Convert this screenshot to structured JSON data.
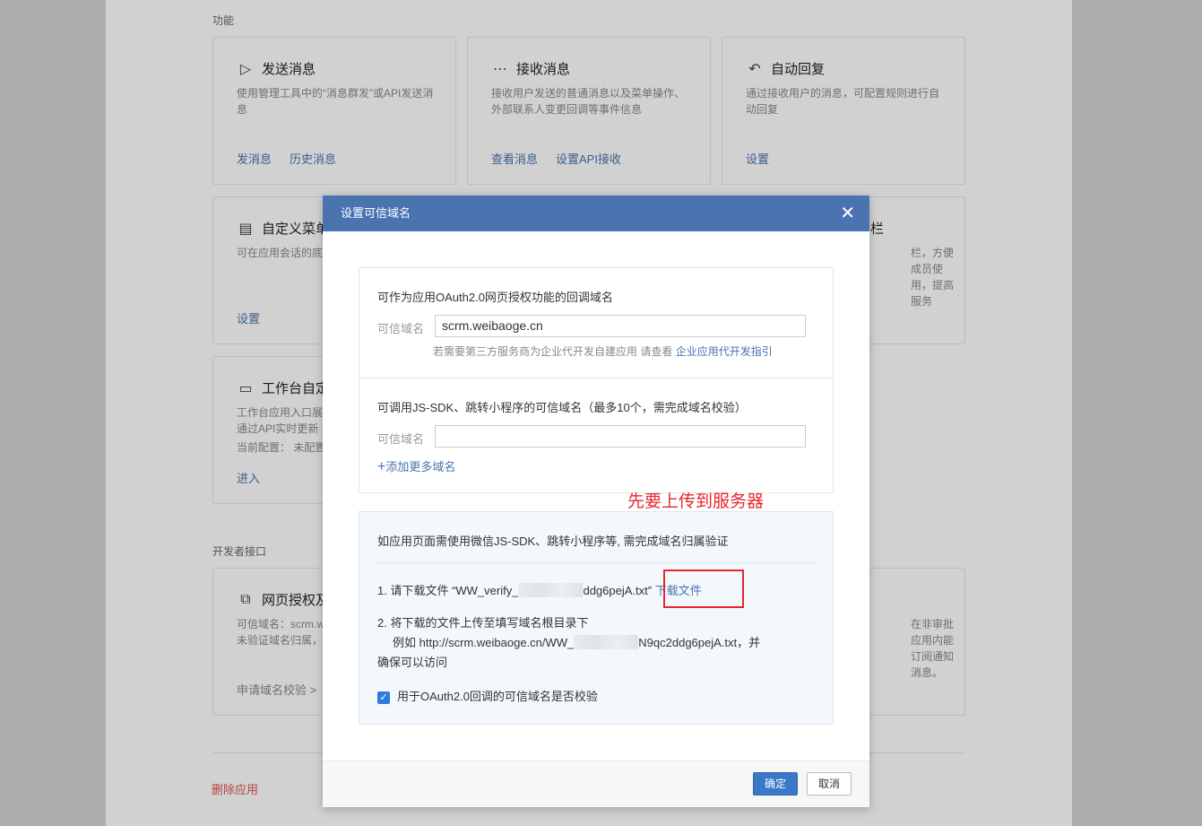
{
  "background": {
    "section_features": "功能",
    "section_dev": "开发者接口",
    "cards": [
      {
        "icon": "send-icon",
        "glyph": "▷",
        "title": "发送消息",
        "desc": "使用管理工具中的“消息群发”或API发送消息",
        "links": [
          "发消息",
          "历史消息"
        ]
      },
      {
        "icon": "chat-icon",
        "glyph": "⋯",
        "title": "接收消息",
        "desc": "接收用户发送的普通消息以及菜单操作、外部联系人变更回调等事件信息",
        "links": [
          "查看消息",
          "设置API接收"
        ]
      },
      {
        "icon": "reply-icon",
        "glyph": "↶",
        "title": "自动回复",
        "desc": "通过接收用户的消息，可配置规则进行自动回复",
        "links": [
          "设置"
        ]
      },
      {
        "icon": "menu-icon",
        "glyph": "▤",
        "title": "自定义菜单",
        "desc": "可在应用会话的底",
        "links": [
          "设置"
        ]
      },
      {
        "icon": "toolbar-icon",
        "glyph": "",
        "title": "栏",
        "desc": "栏，方便成员使用，提高服务",
        "links": []
      },
      {
        "icon": "workbench-icon",
        "glyph": "▭",
        "title": "工作台自定",
        "desc": "工作台应用入口展通过API实时更新",
        "desc2": "当前配置：  未配置",
        "links": [
          "进入"
        ]
      },
      {
        "icon": "oauth-icon",
        "glyph": "⧉",
        "title": "网页授权及",
        "desc": "可信域名：scrm.w未验证域名归属，",
        "links": [
          "申请域名校验 >"
        ]
      },
      {
        "icon": "",
        "glyph": "",
        "title": "",
        "desc": "在非审批应用内能订阅通知消息。",
        "links": []
      }
    ],
    "delete_app": "删除应用"
  },
  "modal": {
    "title": "设置可信域名",
    "close_glyph": "✕",
    "oauth_section": {
      "heading": "可作为应用OAuth2.0网页授权功能的回调域名",
      "field_label": "可信域名",
      "field_value": "scrm.weibaoge.cn",
      "hint_text": "若需要第三方服务商为企业代开发自建应用 请查看",
      "hint_link": "企业应用代开发指引"
    },
    "jssdk_section": {
      "heading": "可调用JS-SDK、跳转小程序的可信域名（最多10个，需完成域名校验）",
      "field_label": "可信域名",
      "field_value": "",
      "add_more": "添加更多域名",
      "add_glyph": "+"
    },
    "verify_section": {
      "intro": "如应用页面需使用微信JS-SDK、跳转小程序等, 需完成域名归属验证",
      "step1_prefix": "1. 请下载文件 “WW_verify_",
      "step1_suffix": "ddg6pejA.txt”",
      "download_link": "下载文件",
      "step2_line1": "2. 将下载的文件上传至填写域名根目录下",
      "step2_line2_prefix": "例如 http://scrm.weibaoge.cn/WW_",
      "step2_line2_suffix": "N9qc2ddg6pejA.txt，并",
      "step2_line3": "确保可以访问",
      "checkbox_label": "用于OAuth2.0回调的可信域名是否校验",
      "checkbox_checked": true
    },
    "annotation": "先要上传到服务器",
    "ok_button": "确定",
    "cancel_button": "取消"
  },
  "colors": {
    "header_blue": "#4a73b0",
    "link_blue": "#4a73b0",
    "annotation_red": "#e8262b",
    "ok_blue": "#3a78c9"
  }
}
